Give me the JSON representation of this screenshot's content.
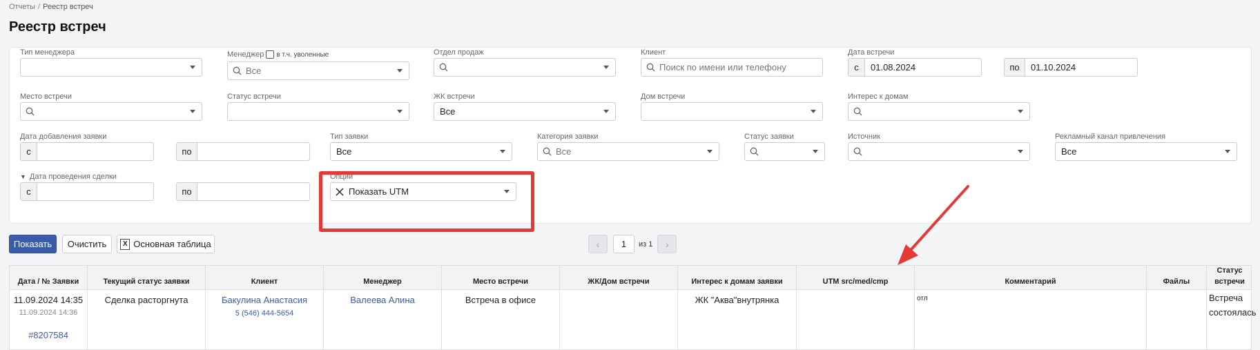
{
  "breadcrumb": {
    "parent": "Отчеты",
    "separator": "/",
    "current": "Реестр встреч"
  },
  "page_title": "Реестр встреч",
  "filters": {
    "manager_type": {
      "label": "Тип менеджера",
      "value": ""
    },
    "manager": {
      "label": "Менеджер",
      "checkbox_label": "в т.ч. уволенные",
      "value": "Все"
    },
    "sales_dept": {
      "label": "Отдел продаж",
      "value": ""
    },
    "client": {
      "label": "Клиент",
      "placeholder": "Поиск по имени или телефону"
    },
    "meeting_date": {
      "label": "Дата встречи",
      "from_prefix": "с",
      "from": "01.08.2024",
      "to_prefix": "по",
      "to": "01.10.2024"
    },
    "meeting_place": {
      "label": "Место встречи",
      "value": ""
    },
    "meeting_status": {
      "label": "Статус встречи",
      "value": ""
    },
    "complex": {
      "label": "ЖК встречи",
      "value": "Все"
    },
    "house": {
      "label": "Дом встречи",
      "value": ""
    },
    "interest": {
      "label": "Интерес к домам",
      "value": ""
    },
    "request_added": {
      "label": "Дата добавления заявки",
      "from_prefix": "с",
      "to_prefix": "по"
    },
    "request_type": {
      "label": "Тип заявки",
      "value": "Все"
    },
    "request_category": {
      "label": "Категория заявки",
      "value": "Все"
    },
    "request_status": {
      "label": "Статус заявки",
      "value": ""
    },
    "source": {
      "label": "Источник",
      "value": ""
    },
    "ad_channel": {
      "label": "Рекламный канал привлечения",
      "value": "Все"
    },
    "deal_date": {
      "label": "Дата проведения сделки",
      "from_prefix": "с",
      "to_prefix": "по"
    },
    "options": {
      "label": "Опции",
      "value": "Показать UTM"
    }
  },
  "buttons": {
    "show": "Показать",
    "clear": "Очистить",
    "main_table": "Основная таблица"
  },
  "pager": {
    "current": "1",
    "of_label": "из 1",
    "prev": "‹",
    "next": "›"
  },
  "table": {
    "headers": [
      "Дата / № Заявки",
      "Текущий статус заявки",
      "Клиент",
      "Менеджер",
      "Место встречи",
      "ЖК/Дом встречи",
      "Интерес к домам заявки",
      "UTM src/med/cmp",
      "Комментарий",
      "Файлы",
      "Статус встречи"
    ],
    "rows": [
      {
        "date": "11.09.2024 14:35",
        "date_small": "11.09.2024 14:36",
        "request_no": "#8207584",
        "status": "Сделка расторгнута",
        "client_name": "Бакулина Анастасия",
        "client_phone": "5 (546) 444-5654",
        "manager": "Валеева Алина",
        "place": "Встреча в офисе",
        "complex": "",
        "interest": "ЖК \"Аква\"внутрянка",
        "utm": "",
        "comment": "отл",
        "files": "",
        "meeting_status": "Встреча состоялась"
      }
    ]
  },
  "colors": {
    "accent": "#3a5ba8",
    "highlight": "#e53935"
  }
}
